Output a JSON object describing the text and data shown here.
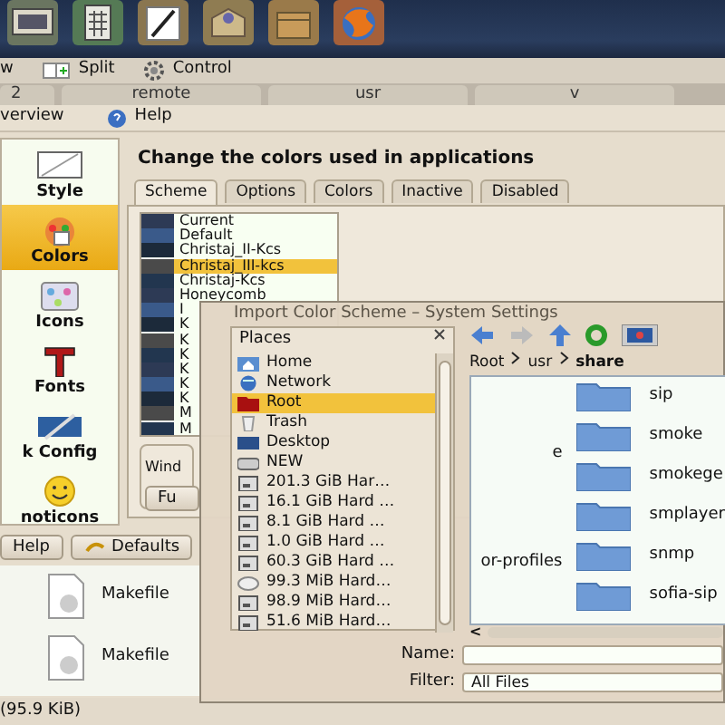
{
  "taskbar": {
    "launchers": [
      {
        "kind": "monitor"
      },
      {
        "kind": "calculator"
      },
      {
        "kind": "pen"
      },
      {
        "kind": "package"
      },
      {
        "kind": "box"
      },
      {
        "kind": "browser"
      }
    ]
  },
  "file_manager": {
    "toolbar": [
      {
        "label": "w",
        "kind": "plain"
      },
      {
        "label": "Split",
        "kind": "split"
      },
      {
        "label": "Control",
        "kind": "gear"
      }
    ],
    "tabs": [
      {
        "label": "2"
      },
      {
        "label": "remote"
      },
      {
        "label": "usr"
      },
      {
        "label": "v"
      }
    ],
    "files": [
      {
        "name": "Makefile"
      },
      {
        "name": "Makefile"
      }
    ],
    "status": "(95.9 KiB)"
  },
  "settings": {
    "toolbar": [
      {
        "label": "verview",
        "kind": "plain"
      },
      {
        "label": "Help",
        "kind": "help"
      }
    ],
    "sidebar": [
      {
        "label": "Style",
        "kind": "style",
        "selected": false
      },
      {
        "label": "Colors",
        "kind": "colors",
        "selected": true
      },
      {
        "label": "Icons",
        "kind": "icons",
        "selected": false
      },
      {
        "label": "Fonts",
        "kind": "fonts",
        "selected": false
      },
      {
        "label": "k Config",
        "kind": "config",
        "selected": false
      },
      {
        "label": "noticons",
        "kind": "smiley",
        "selected": false
      }
    ],
    "heading": "Change the colors used in applications",
    "tabs": [
      {
        "label": "Scheme",
        "selected": true
      },
      {
        "label": "Options",
        "selected": false
      },
      {
        "label": "Colors",
        "selected": false
      },
      {
        "label": "Inactive",
        "selected": false
      },
      {
        "label": "Disabled",
        "selected": false
      }
    ],
    "schemes": [
      {
        "label": "Current",
        "selected": false
      },
      {
        "label": "Default",
        "selected": false
      },
      {
        "label": "Christaj_II-Kcs",
        "selected": false
      },
      {
        "label": "Christaj_III-kcs",
        "selected": true
      },
      {
        "label": "Christaj-Kcs",
        "selected": false
      },
      {
        "label": "Honeycomb",
        "selected": false
      },
      {
        "label": "I",
        "selected": false
      },
      {
        "label": "K",
        "selected": false
      },
      {
        "label": "K",
        "selected": false
      },
      {
        "label": "K",
        "selected": false
      },
      {
        "label": "K",
        "selected": false
      },
      {
        "label": "K",
        "selected": false
      },
      {
        "label": "K",
        "selected": false
      },
      {
        "label": "M",
        "selected": false
      },
      {
        "label": "M",
        "selected": false
      }
    ],
    "group_label": "Wind",
    "group_button": "Fu",
    "buttons": [
      {
        "label": "Help",
        "kind": "plain"
      },
      {
        "label": "Defaults",
        "kind": "defaults"
      }
    ]
  },
  "dialog": {
    "title": "Import Color Scheme – System Settings",
    "places_title": "Places",
    "places": [
      {
        "label": "Home",
        "kind": "home",
        "selected": false
      },
      {
        "label": "Network",
        "kind": "network",
        "selected": false
      },
      {
        "label": "Root",
        "kind": "root",
        "selected": true
      },
      {
        "label": "Trash",
        "kind": "trash",
        "selected": false
      },
      {
        "label": "Desktop",
        "kind": "desktop",
        "selected": false
      },
      {
        "label": "NEW",
        "kind": "drive",
        "selected": false
      },
      {
        "label": "201.3 GiB Har…",
        "kind": "disk",
        "selected": false
      },
      {
        "label": "16.1 GiB Hard …",
        "kind": "disk",
        "selected": false
      },
      {
        "label": "8.1 GiB Hard …",
        "kind": "disk",
        "selected": false
      },
      {
        "label": "1.0 GiB Hard …",
        "kind": "disk",
        "selected": false
      },
      {
        "label": "60.3 GiB Hard …",
        "kind": "disk",
        "selected": false
      },
      {
        "label": "99.3 MiB Hard…",
        "kind": "usb",
        "selected": false
      },
      {
        "label": "98.9 MiB Hard…",
        "kind": "disk",
        "selected": false
      },
      {
        "label": "51.6 MiB Hard…",
        "kind": "disk",
        "selected": false
      }
    ],
    "breadcrumb": [
      {
        "label": "Root",
        "current": false
      },
      {
        "label": "usr",
        "current": false
      },
      {
        "label": "share",
        "current": true
      }
    ],
    "left_column": [
      "e",
      "or-profiles"
    ],
    "folders": [
      "sip",
      "smoke",
      "smokege",
      "smplayer",
      "snmp",
      "sofia-sip"
    ],
    "scroll_arrow": "<",
    "name_label": "Name:",
    "filter_label": "Filter:",
    "filter_value": "All Files"
  }
}
